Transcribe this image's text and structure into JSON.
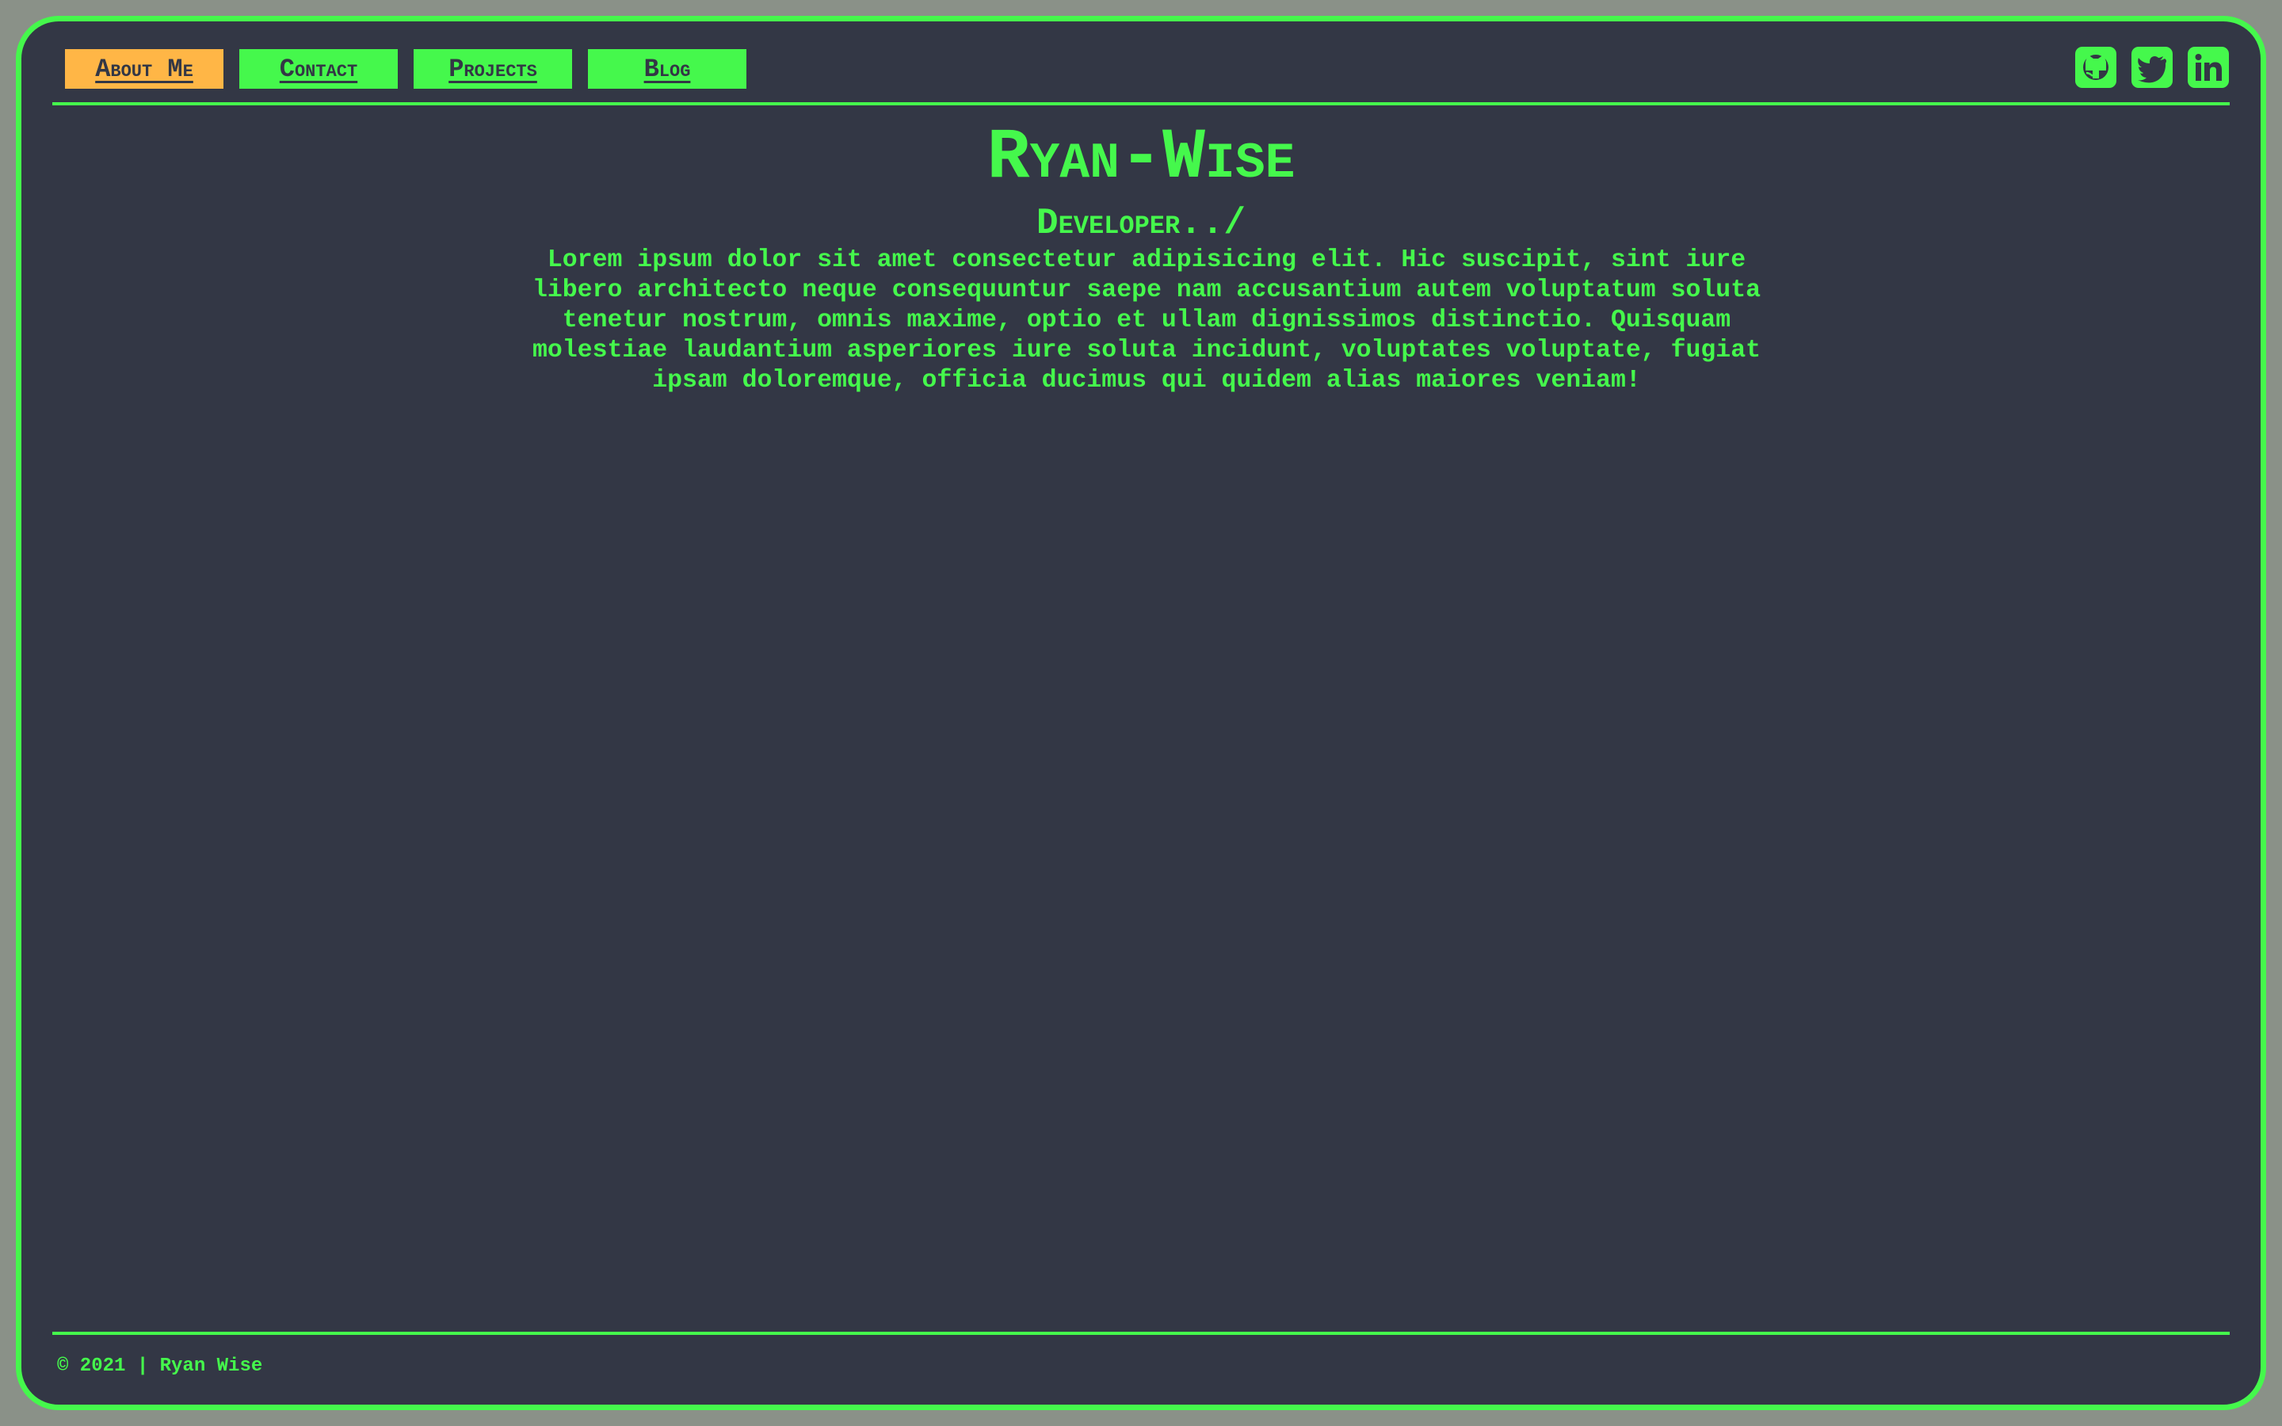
{
  "nav": {
    "items": [
      {
        "label": "About Me",
        "active": true
      },
      {
        "label": "Contact",
        "active": false
      },
      {
        "label": "Projects",
        "active": false
      },
      {
        "label": "Blog",
        "active": false
      }
    ]
  },
  "social": {
    "icons": [
      "github-icon",
      "twitter-icon",
      "linkedin-icon"
    ]
  },
  "header": {
    "title": "Ryan-Wise",
    "subtitle": "Developer../"
  },
  "main": {
    "intro": "Lorem ipsum dolor sit amet consectetur adipisicing elit. Hic suscipit, sint iure libero architecto neque consequuntur saepe nam accusantium autem voluptatum soluta tenetur nostrum, omnis maxime, optio et ullam dignissimos distinctio. Quisquam molestiae laudantium asperiores iure soluta incidunt, voluptates voluptate, fugiat ipsam doloremque, officia ducimus qui quidem alias maiores veniam!"
  },
  "footer": {
    "copyright": "© 2021 | Ryan Wise"
  },
  "colors": {
    "background": "#333745",
    "accent": "#45f84c",
    "active": "#ffb646",
    "outer": "#8a9188"
  }
}
